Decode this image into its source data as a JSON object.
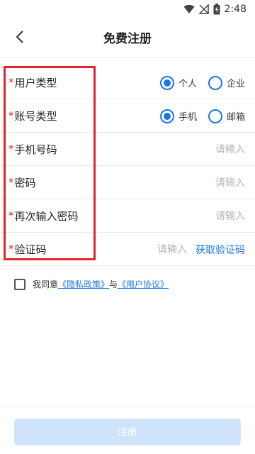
{
  "status_bar": {
    "time": "2:48"
  },
  "header": {
    "title": "免费注册"
  },
  "form": {
    "required_mark": "*",
    "user_type": {
      "label": "用户类型",
      "options": [
        {
          "label": "个人",
          "checked": true
        },
        {
          "label": "企业",
          "checked": false
        }
      ]
    },
    "account_type": {
      "label": "账号类型",
      "options": [
        {
          "label": "手机",
          "checked": true
        },
        {
          "label": "邮箱",
          "checked": false
        }
      ]
    },
    "phone": {
      "label": "手机号码",
      "placeholder": "请输入",
      "value": ""
    },
    "password": {
      "label": "密码",
      "placeholder": "请输入",
      "value": ""
    },
    "confirm_password": {
      "label": "再次输入密码",
      "placeholder": "请输入",
      "value": ""
    },
    "verification_code": {
      "label": "验证码",
      "placeholder": "请输入",
      "value": "",
      "get_code_label": "获取验证码"
    }
  },
  "agreement": {
    "prefix": "我同意",
    "privacy_link": "《隐私政策》",
    "conjunction": "与",
    "user_agreement_link": "《用户协议》",
    "checked": false
  },
  "footer": {
    "register_label": "注册"
  },
  "colors": {
    "accent": "#1a75e6",
    "required": "#d9262a",
    "highlight": "#e0262a",
    "disabled_button": "#cfe3fb"
  }
}
